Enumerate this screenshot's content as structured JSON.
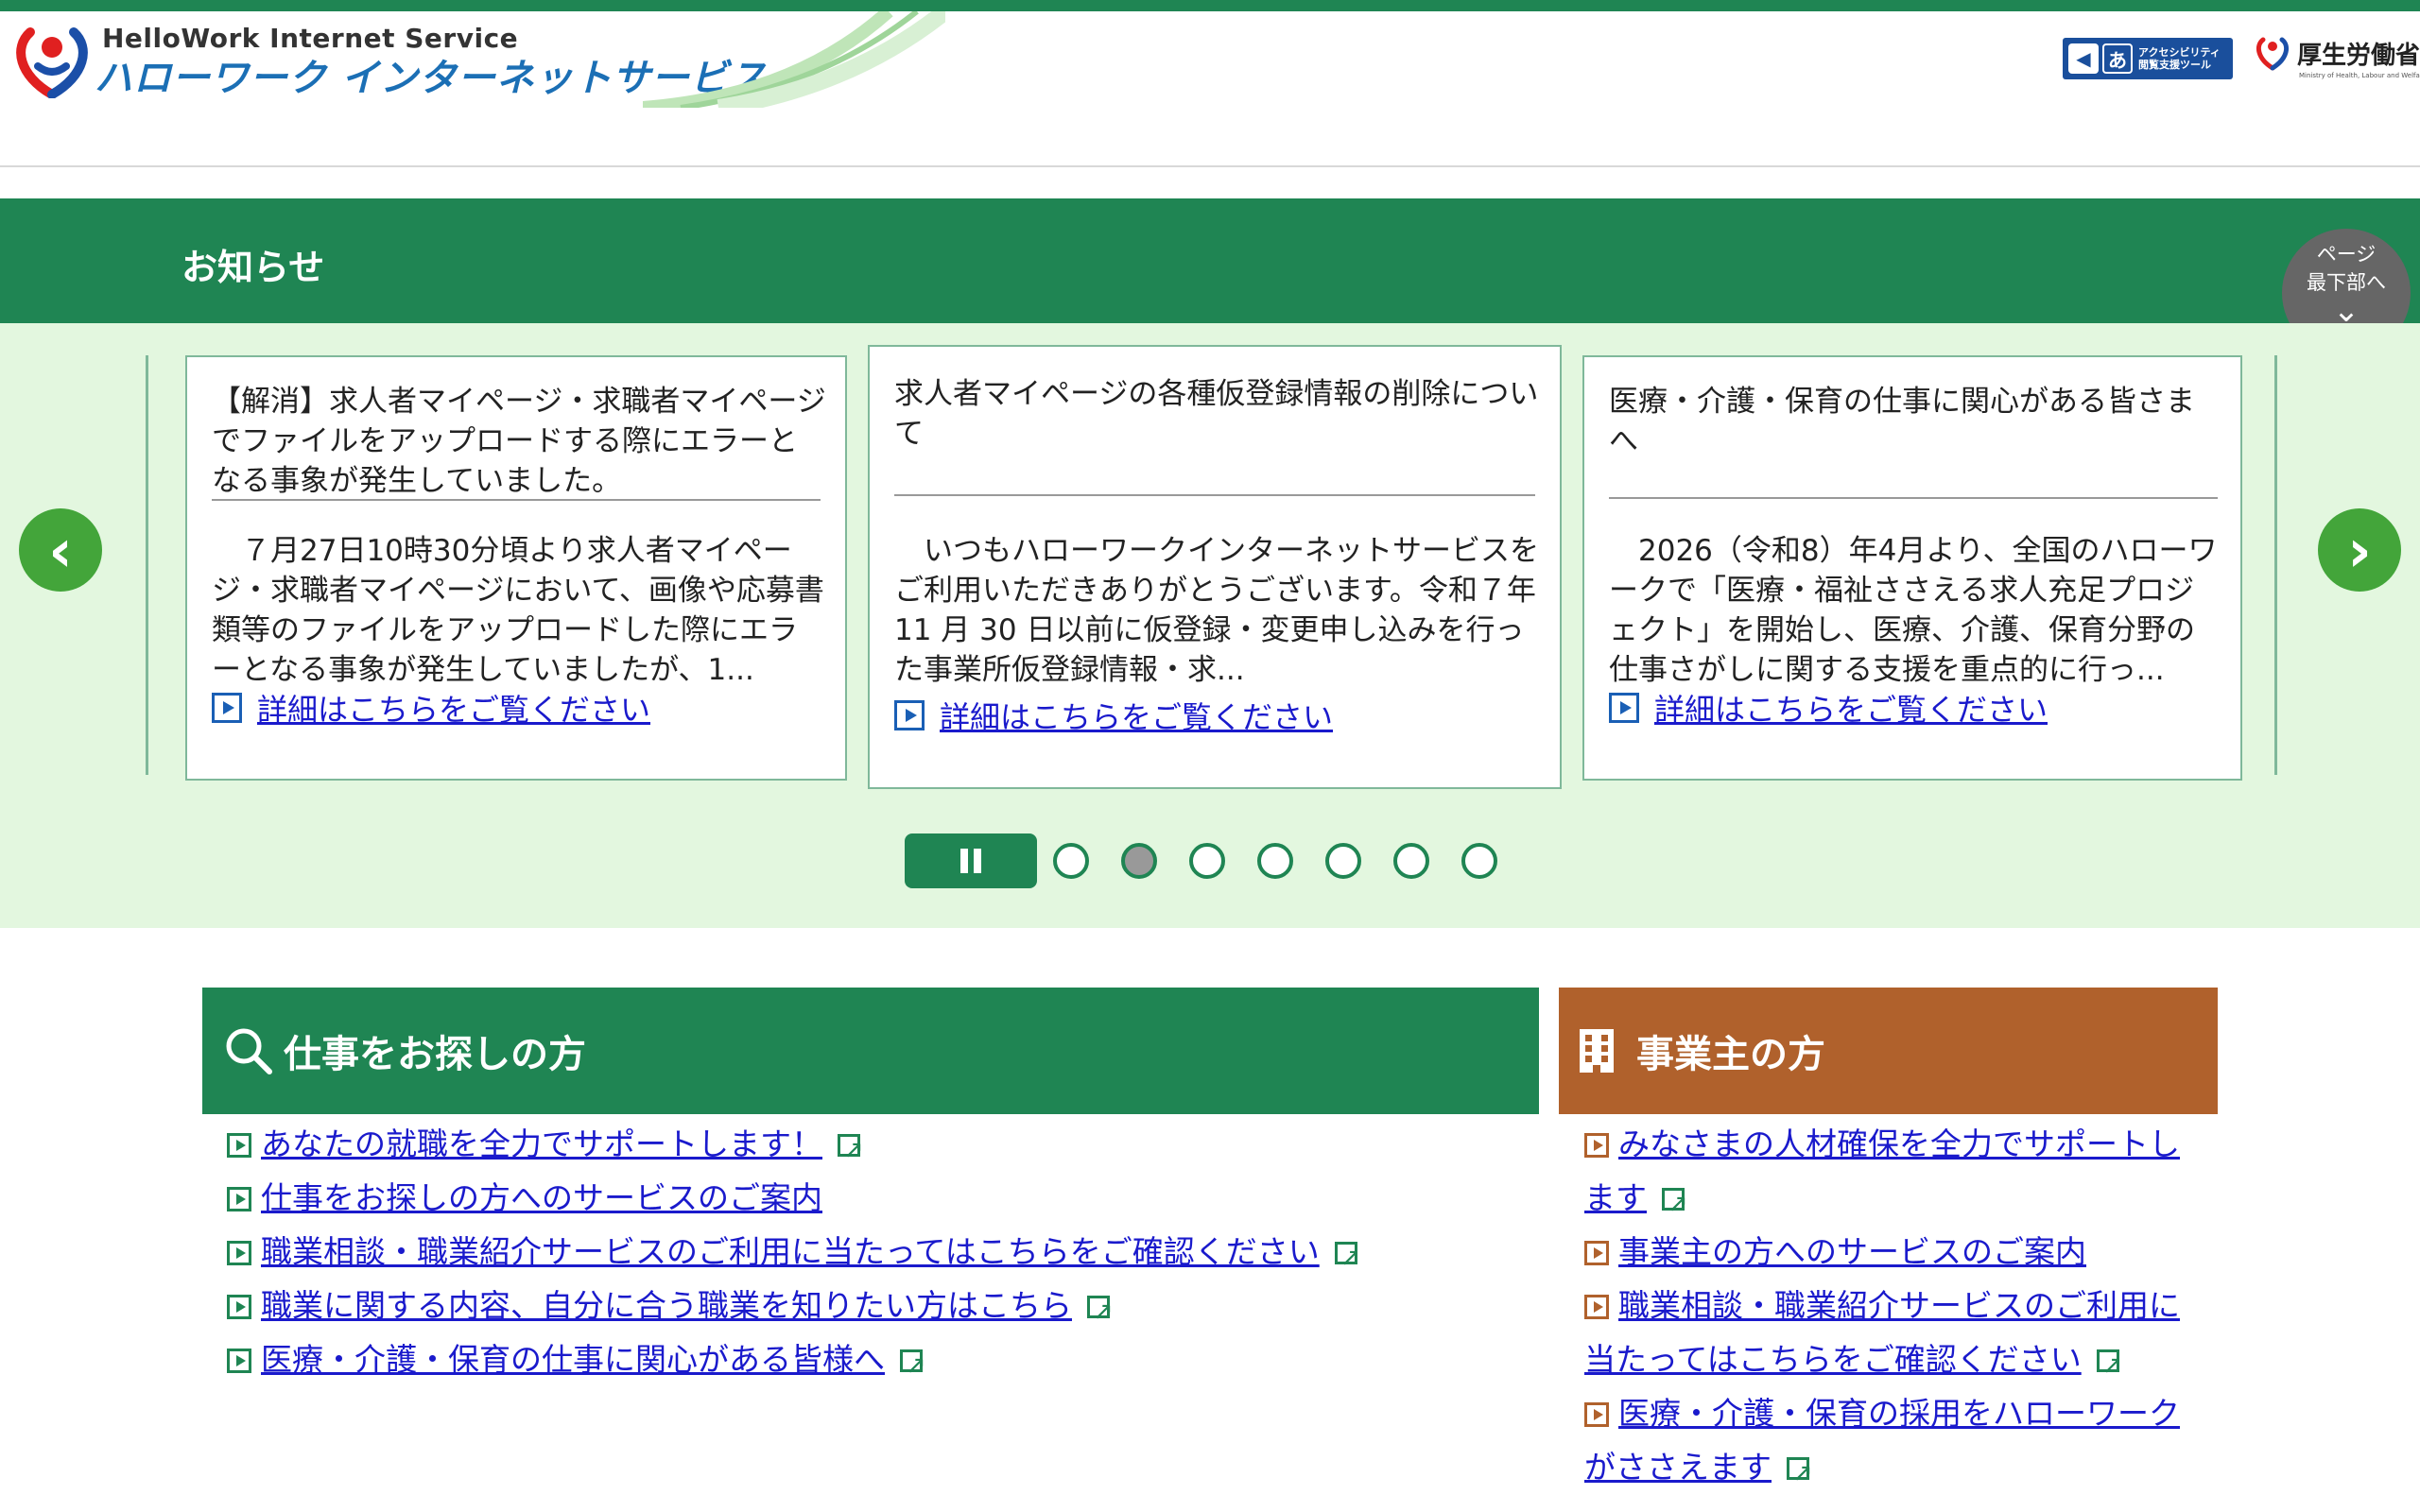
{
  "header": {
    "logo_en": "HelloWork Internet Service",
    "logo_jp": "ハローワーク インターネットサービス",
    "access_tool_label": "アクセシビリティ閲覧支援ツール",
    "access_tool_line1": "アクセシビリティ",
    "access_tool_line2": "閲覧支援ツール",
    "mhlw_name": "厚生労働省",
    "mhlw_sub": "Ministry of Health, Labour and Welfare"
  },
  "news": {
    "title": "お知らせ",
    "page_bottom_line1": "ページ",
    "page_bottom_line2": "最下部へ",
    "cards": [
      {
        "title": "【解消】求人者マイページ・求職者マイページでファイルをアップロードする際にエラーとなる事象が発生していました。",
        "body": "　７月27日10時30分頃より求人者マイページ・求職者マイページにおいて、画像や応募書類等のファイルをアップロードした際にエラーとなる事象が発生していましたが、1...",
        "link": "詳細はこちらをご覧ください"
      },
      {
        "title": "求人者マイページの各種仮登録情報の削除について",
        "body": "　いつもハローワークインターネットサービスをご利用いただきありがとうございます。令和７年 11 月 30 日以前に仮登録・変更申し込みを行った事業所仮登録情報・求...",
        "link": "詳細はこちらをご覧ください"
      },
      {
        "title": "医療・介護・保育の仕事に関心がある皆さまへ",
        "body": "　2026（令和8）年4月より、全国のハローワークで「医療・福祉ささえる求人充足プロジェクト」を開始し、医療、介護、保育分野の仕事さがしに関する支援を重点的に行っ...",
        "link": "詳細はこちらをご覧ください"
      }
    ],
    "active_dot": 1,
    "dot_count": 7
  },
  "jobseeker": {
    "title": "仕事をお探しの方",
    "links": [
      "あなたの就職を全力でサポートします！",
      "仕事をお探しの方へのサービスのご案内",
      "職業相談・職業紹介サービスのご利用に当たってはこちらをご確認ください",
      "職業に関する内容、自分に合う職業を知りたい方はこちら",
      "医療・介護・保育の仕事に関心がある皆様へ"
    ]
  },
  "employer": {
    "title": "事業主の方",
    "links": [
      "みなさまの人材確保を全力でサポートします",
      "事業主の方へのサービスのご案内",
      "職業相談・職業紹介サービスのご利用に当たってはこちらをご確認ください",
      "医療・介護・保育の採用をハローワークがささえます"
    ]
  },
  "icons": {
    "search": "search-icon",
    "building": "building-icon",
    "play": "play-icon",
    "external": "external-link-icon"
  },
  "colors": {
    "brand_green": "#1f8553",
    "light_green": "#e3f7df",
    "employer_brown": "#b0612c",
    "link_blue": "#1a1acc"
  }
}
